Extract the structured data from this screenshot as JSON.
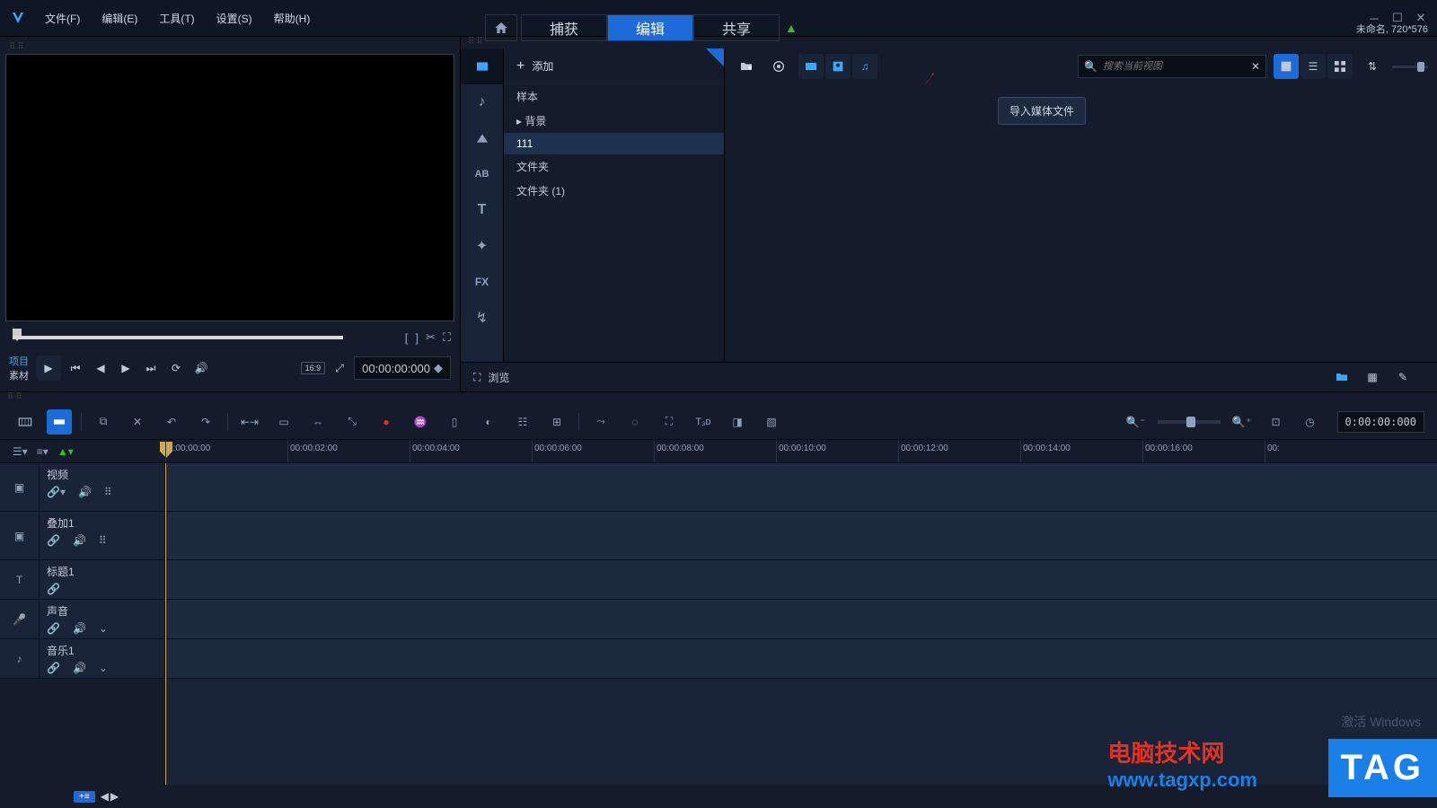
{
  "app": {
    "logo": "V"
  },
  "menu": {
    "file": "文件(F)",
    "edit": "编辑(E)",
    "tools": "工具(T)",
    "settings": "设置(S)",
    "help": "帮助(H)"
  },
  "topnav": {
    "capture": "捕获",
    "edit": "编辑",
    "share": "共享"
  },
  "project": {
    "status": "未命名, 720*576"
  },
  "player": {
    "tab_project": "项目",
    "tab_material": "素材",
    "ratio": "16:9",
    "timecode": "00:00:00:000"
  },
  "library": {
    "add": "添加",
    "folders": {
      "sample": "样本",
      "background": "背景",
      "f111": "111",
      "folder": "文件夹",
      "folder1": "文件夹 (1)"
    },
    "search_placeholder": "搜索当前视图",
    "tooltip": "导入媒体文件",
    "browse": "浏览"
  },
  "timeline": {
    "toolbar_timecode": "0:00:00:000",
    "ruler": [
      "0:00:00:00",
      "00:00:02:00",
      "00:00:04:00",
      "00:00:06:00",
      "00:00:08:00",
      "00:00:10:00",
      "00:00:12:00",
      "00:00:14:00",
      "00:00:16:00",
      "00:"
    ],
    "tracks": {
      "video": "视频",
      "overlay1": "叠加1",
      "title1": "标题1",
      "voice": "声音",
      "music1": "音乐1"
    }
  },
  "watermark": {
    "site_cn": "电脑技术网",
    "site_url": "www.tagxp.com",
    "tag": "TAG",
    "activate": "激活 Windows"
  }
}
